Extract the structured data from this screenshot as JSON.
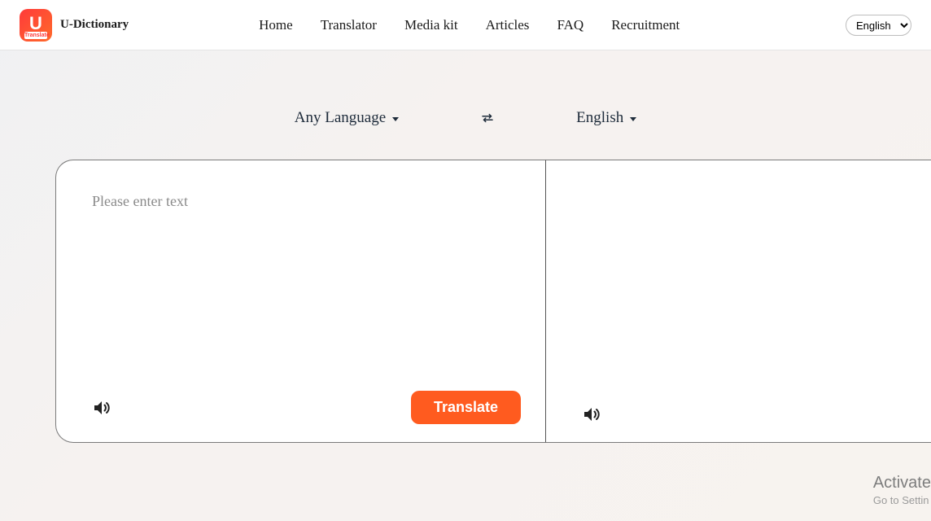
{
  "header": {
    "brand": "U-Dictionary",
    "logo_sub": "Translate",
    "nav": {
      "home": "Home",
      "translator": "Translator",
      "media_kit": "Media kit",
      "articles": "Articles",
      "faq": "FAQ",
      "recruitment": "Recruitment"
    },
    "lang_select_value": "English"
  },
  "translator": {
    "source_lang": "Any Language",
    "target_lang": "English",
    "input_placeholder": "Please enter text",
    "input_value": "",
    "translate_button": "Translate"
  },
  "watermark": {
    "line1": "Activate ",
    "line2": "Go to Settin"
  },
  "icons": {
    "swap": "swap-icon",
    "caret": "caret-down-icon",
    "speaker": "speaker-icon"
  }
}
